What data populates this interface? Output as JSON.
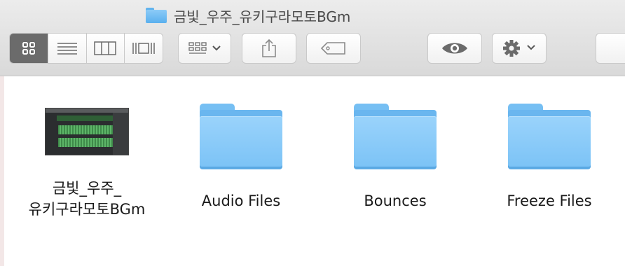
{
  "window": {
    "title": "금빛_우주_유키구라모토BGm"
  },
  "toolbar": {
    "view_modes": [
      "icon-view",
      "list-view",
      "column-view",
      "cover-flow-view"
    ],
    "active_view": "icon-view",
    "arrange_icon": "grid-arrange-icon",
    "share_icon": "share-icon",
    "tag_icon": "tag-icon",
    "quicklook_icon": "eye-icon",
    "action_icon": "gear-icon"
  },
  "items": [
    {
      "label_line1": "금빛_우주_",
      "label_line2": "유키구라모토BGm",
      "type": "garageband-project"
    },
    {
      "label_line1": "Audio Files",
      "type": "folder"
    },
    {
      "label_line1": "Bounces",
      "type": "folder"
    },
    {
      "label_line1": "Freeze Files",
      "type": "folder"
    }
  ],
  "colors": {
    "folder": "#7cc3f6",
    "toolbar": "#e3e3e3"
  }
}
